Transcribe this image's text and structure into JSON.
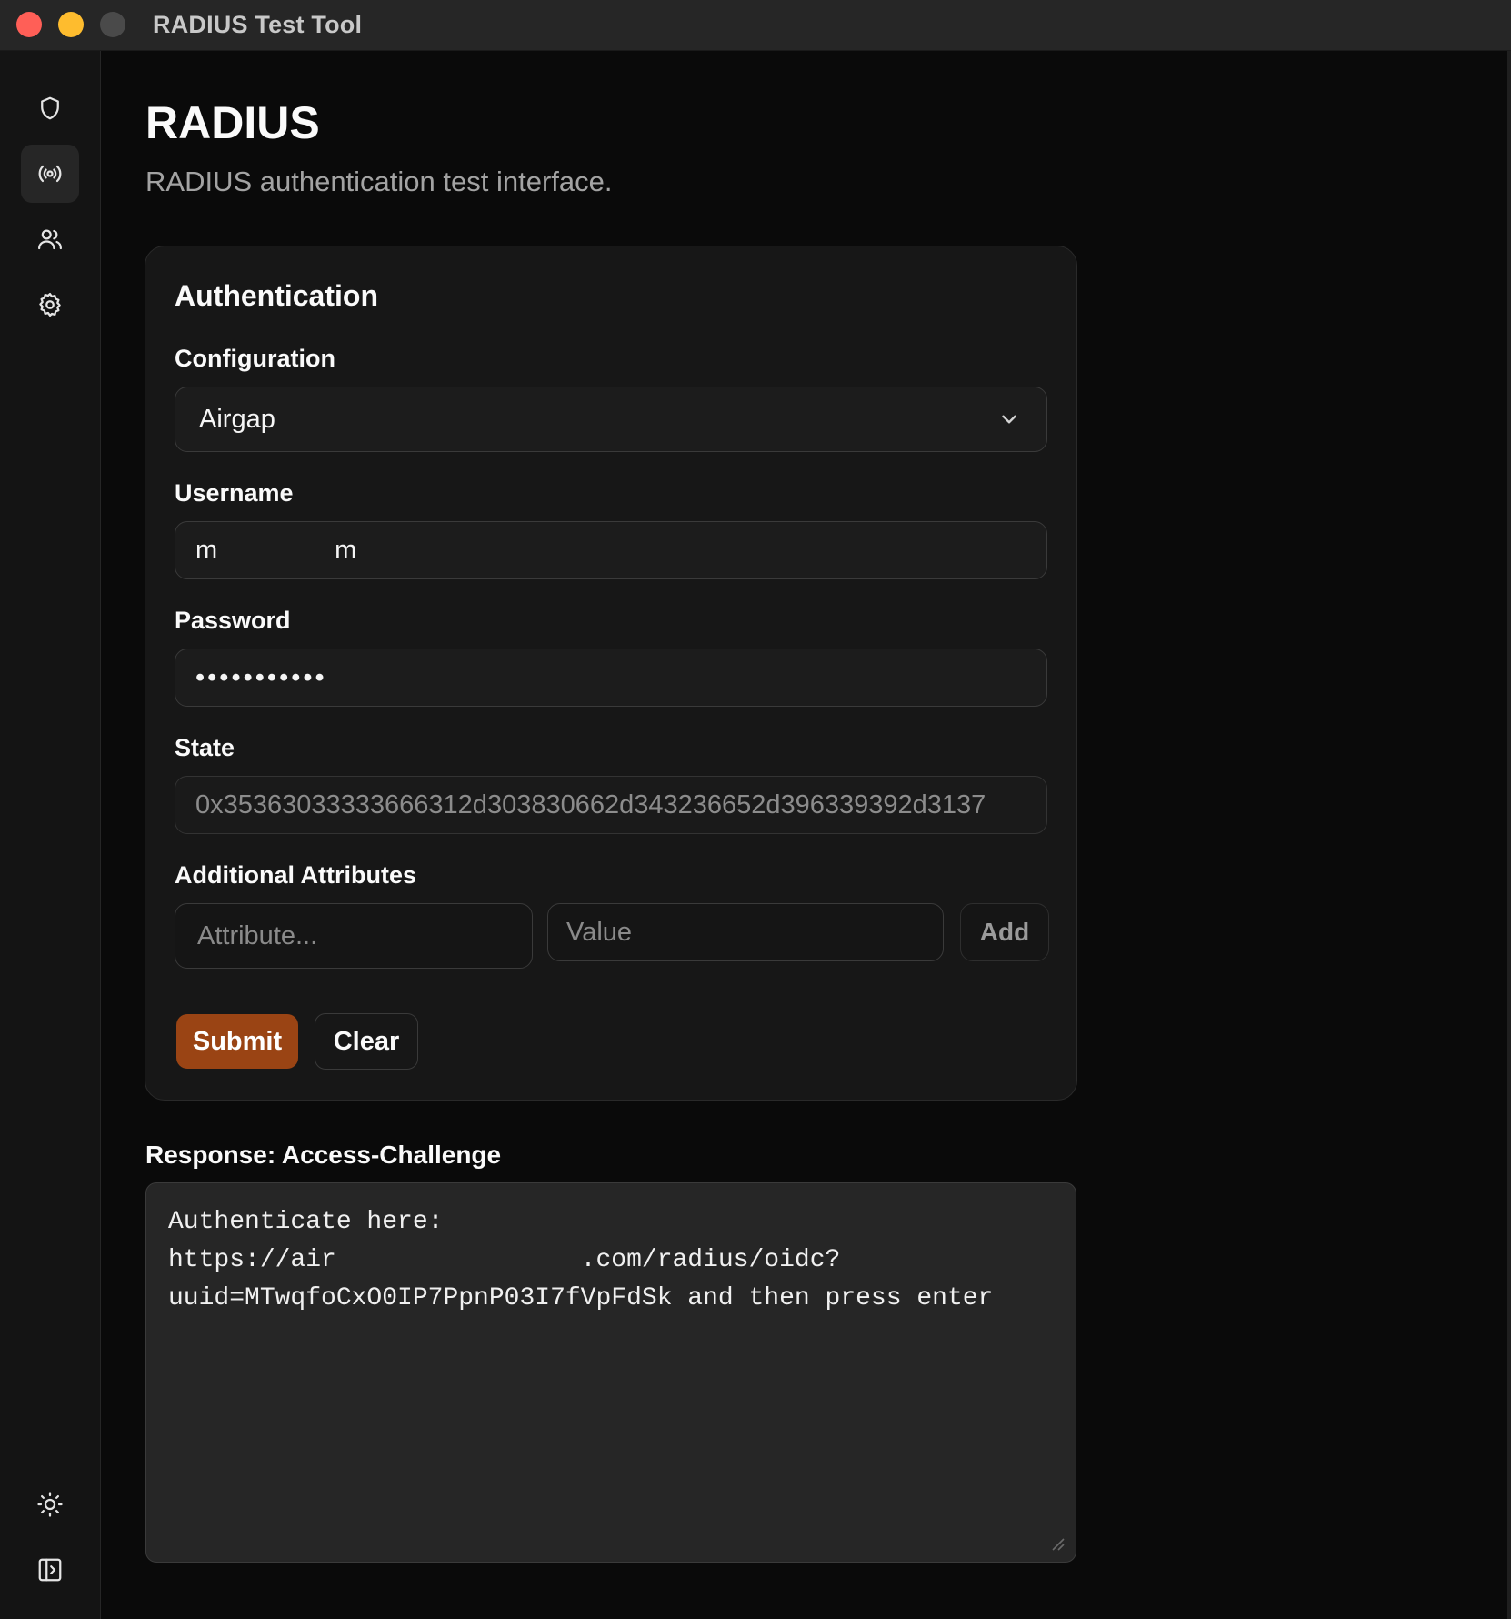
{
  "window": {
    "title": "RADIUS Test Tool"
  },
  "sidebar": {
    "items": [
      {
        "name": "shield",
        "icon": "shield-icon"
      },
      {
        "name": "radius",
        "icon": "broadcast-icon",
        "active": true
      },
      {
        "name": "users",
        "icon": "users-icon"
      },
      {
        "name": "settings",
        "icon": "gear-icon"
      }
    ],
    "bottom_items": [
      {
        "name": "theme",
        "icon": "sun-icon"
      },
      {
        "name": "toggle-sidebar",
        "icon": "sidebar-toggle-icon"
      }
    ]
  },
  "page": {
    "title": "RADIUS",
    "subtitle": "RADIUS authentication test interface."
  },
  "auth_card": {
    "title": "Authentication",
    "configuration": {
      "label": "Configuration",
      "value": "Airgap"
    },
    "username": {
      "label": "Username",
      "value": "m                m"
    },
    "password": {
      "label": "Password",
      "value": "•••••••••••"
    },
    "state": {
      "label": "State",
      "value": "0x35363033333666312d303830662d343236652d396339392d3137"
    },
    "attributes": {
      "label": "Additional Attributes",
      "attribute_placeholder": "Attribute...",
      "value_placeholder": "Value",
      "add_label": "Add"
    },
    "submit_label": "Submit",
    "clear_label": "Clear"
  },
  "response": {
    "label": "Response: Access-Challenge",
    "text": "Authenticate here:\nhttps://air                .com/radius/oidc?\nuuid=MTwqfoCxO0IP7PpnP03I7fVpFdSk and then press enter"
  },
  "colors": {
    "background": "#0a0a0a",
    "card": "#171717",
    "accent": "#9a4414",
    "traffic_close": "#ff5f57",
    "traffic_min": "#febc2e"
  }
}
